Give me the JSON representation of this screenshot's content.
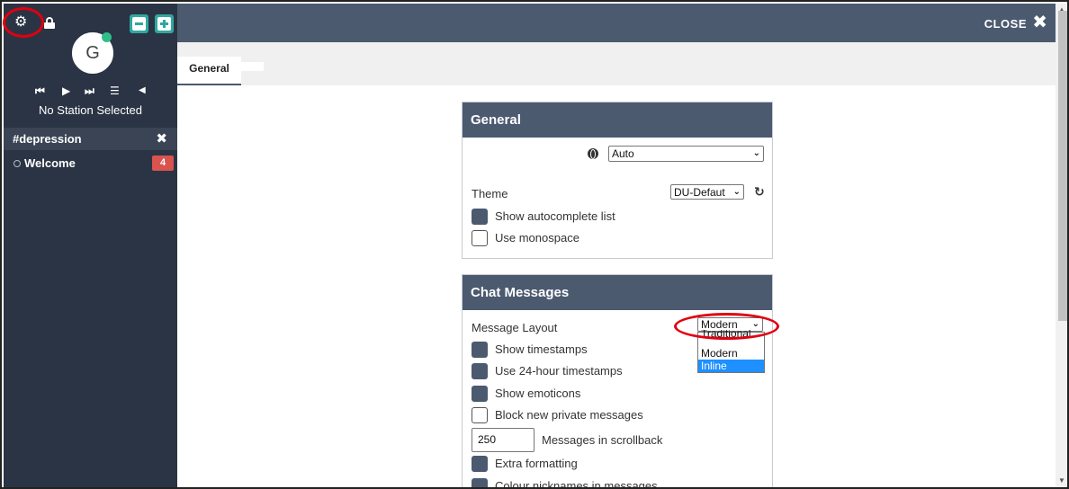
{
  "sidebar": {
    "avatar_letter": "G",
    "station": "No Station Selected",
    "channels": [
      {
        "name": "#depression",
        "close": "✖"
      },
      {
        "name": "Welcome",
        "badge": "4"
      }
    ]
  },
  "header": {
    "close_label": "CLOSE",
    "close_icon": "✖"
  },
  "tabs": [
    {
      "label": "General"
    }
  ],
  "general": {
    "title": "General",
    "language_value": "Auto",
    "theme_label": "Theme",
    "theme_value": "DU-Defaut",
    "options": [
      {
        "label": "Show autocomplete list",
        "checked": true
      },
      {
        "label": "Use monospace",
        "checked": false
      }
    ]
  },
  "chat": {
    "title": "Chat Messages",
    "layout_label": "Message Layout",
    "layout_value": "Modern",
    "layout_options": [
      "Traditional",
      "Modern",
      "Inline"
    ],
    "options": [
      {
        "label": "Show timestamps",
        "checked": true
      },
      {
        "label": "Use 24-hour timestamps",
        "checked": true
      },
      {
        "label": "Show emoticons",
        "checked": true
      },
      {
        "label": "Block new private messages",
        "checked": false
      }
    ],
    "scrollback_value": "250",
    "scrollback_label": "Messages in scrollback",
    "options_after": [
      {
        "label": "Extra formatting",
        "checked": true
      },
      {
        "label": "Colour nicknames in messages",
        "checked": true
      }
    ]
  },
  "colors": {
    "sidebar_bg": "#2b3444",
    "header_bg": "#4c5a70",
    "accent_teal": "#2fa8a0",
    "badge_red": "#d9534f",
    "annotation_red": "#e0000f"
  }
}
